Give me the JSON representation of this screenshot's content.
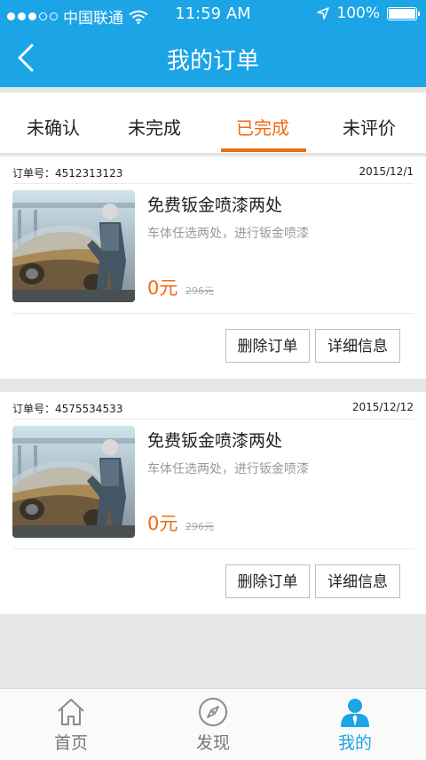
{
  "status_bar": {
    "carrier": "中国联通",
    "time": "11:59 AM",
    "battery": "100%",
    "signal_icon": "signal-dots-icon",
    "wifi_icon": "wifi-icon",
    "location_icon": "location-arrow-icon",
    "battery_icon": "battery-icon"
  },
  "nav": {
    "title": "我的订单",
    "back_icon": "chevron-left-icon"
  },
  "tabs": [
    {
      "label": "未确认"
    },
    {
      "label": "未完成"
    },
    {
      "label": "已完成",
      "active": true
    },
    {
      "label": "未评价"
    }
  ],
  "orders": [
    {
      "order_no": "订单号：4512313123",
      "date": "2015/12/1",
      "title": "免费钣金喷漆两处",
      "desc": "车体任选两处，进行钣金喷漆",
      "price": "0元",
      "old_price": "296元",
      "delete_label": "删除订单",
      "detail_label": "详细信息"
    },
    {
      "order_no": "订单号：4575534533",
      "date": "2015/12/12",
      "title": "免费钣金喷漆两处",
      "desc": "车体任选两处，进行钣金喷漆",
      "price": "0元",
      "old_price": "296元",
      "delete_label": "删除订单",
      "detail_label": "详细信息"
    }
  ],
  "tabbar": [
    {
      "label": "首页",
      "icon": "home-icon"
    },
    {
      "label": "发现",
      "icon": "compass-icon"
    },
    {
      "label": "我的",
      "icon": "person-icon",
      "active": true
    }
  ],
  "colors": {
    "primary": "#1ba5e6",
    "accent": "#f26a12",
    "background": "#e6e6e6"
  }
}
